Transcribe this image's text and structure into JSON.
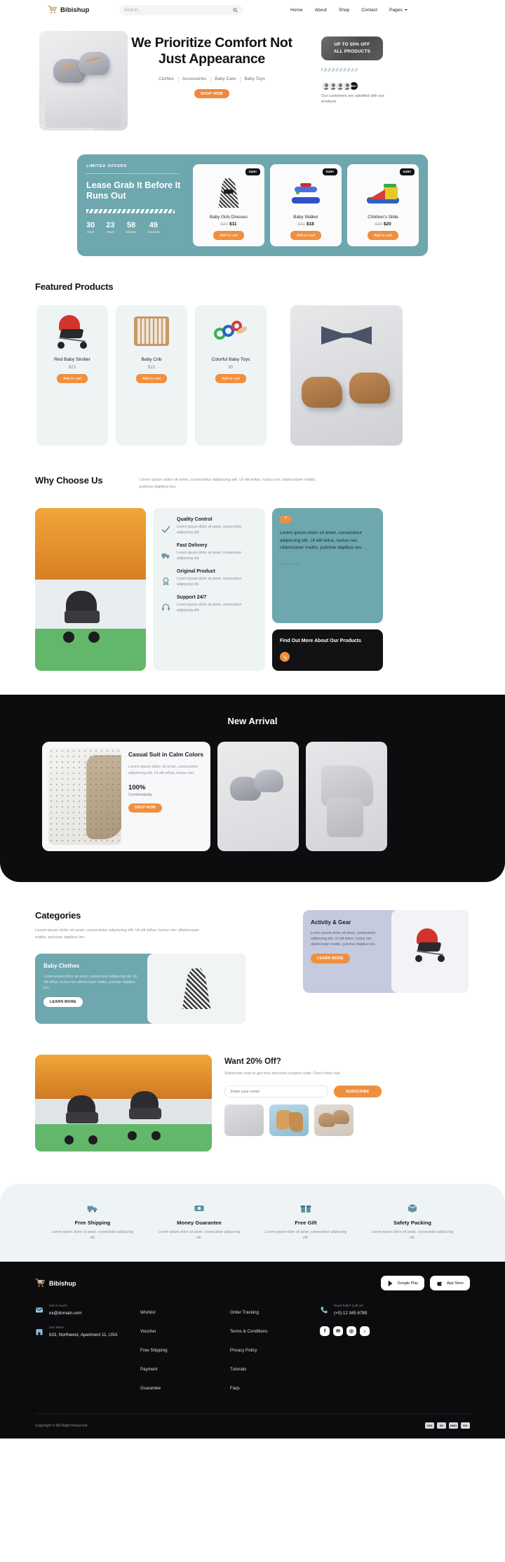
{
  "header": {
    "brand": "Bibishup",
    "search": {
      "placeholder": "Search...",
      "value": ""
    },
    "nav": [
      {
        "label": "Home"
      },
      {
        "label": "About"
      },
      {
        "label": "Shop"
      },
      {
        "label": "Contact"
      },
      {
        "label": "Pages"
      }
    ]
  },
  "hero": {
    "title": "We Prioritize Comfort Not Just Appearance",
    "categories": [
      "Clothes",
      "Accessories",
      "Baby Care",
      "Baby Toys"
    ],
    "cta": "SHOP NOW",
    "promo_line1": "UP TO 50% OFF",
    "promo_line2": "ALL PRODUCTS",
    "avatar_more": "500+",
    "caption": "Our customers are satisfied with our products"
  },
  "offers": {
    "kicker": "LIMITED OFFERS",
    "title": "Lease Grab It Before It Runs Out",
    "countdown": [
      {
        "value": "30",
        "label": "Days"
      },
      {
        "value": "23",
        "label": "Hours"
      },
      {
        "value": "58",
        "label": "Minutes"
      },
      {
        "value": "49",
        "label": "Seconds"
      }
    ],
    "badge": "Sale!",
    "add_to_cart": "Add to cart",
    "products": [
      {
        "name": "Baby Girls Dresses",
        "old_price": "$24",
        "price": "$11"
      },
      {
        "name": "Baby Walker",
        "old_price": "$31",
        "price": "$18"
      },
      {
        "name": "Children's Slide",
        "old_price": "$39",
        "price": "$20"
      }
    ]
  },
  "featured": {
    "title": "Featured Products",
    "add_to_cart": "Add to cart",
    "products": [
      {
        "name": "Red Baby Stroller",
        "price": "$23"
      },
      {
        "name": "Baby Crib",
        "price": "$15"
      },
      {
        "name": "Colorful Baby Toys",
        "price": "$5"
      }
    ]
  },
  "why": {
    "title": "Why Choose Us",
    "description": "Lorem ipsum dolor sit amet, consectetur adipiscing elit. Ut elit tellus, luctus nec ullamcorper mattis, pulvinar dapibus leo.",
    "items": [
      {
        "title": "Quality Control",
        "text": "Lorem ipsum dolor sit amet, consectetur adipiscing elit."
      },
      {
        "title": "Fast Delivery",
        "text": "Lorem ipsum dolor sit amet, consectetur adipiscing elit."
      },
      {
        "title": "Original Product",
        "text": "Lorem ipsum dolor sit amet, consectetur adipiscing elit."
      },
      {
        "title": "Support 24/7",
        "text": "Lorem ipsum dolor sit amet, consectetur adipiscing elit."
      }
    ],
    "quote_mark": "“",
    "quote": "Lorem ipsum dolor sit amet, consectetur adipiscing elit. Ut elit tellus, luctus nec ullamcorper mattis, pulvinar dapibus leo.",
    "quote_author": "5.000 reviews",
    "dark_title": "Find Out More About Our Products",
    "dark_arrow": "↘"
  },
  "arrival": {
    "title": "New Arrival",
    "product_title": "Casual Suit in Calm Colors",
    "product_text": "Lorem ipsum dolor sit amet, consectetur adipiscing elit. Ut elit tellus, luctus nec.",
    "percent": "100%",
    "percent_label": "Comfortability",
    "cta": "SHOP NOW"
  },
  "categories": {
    "title": "Categories",
    "description": "Lorem ipsum dolor sit amet, consectetur adipiscing elit. Ut elit tellus, luctus nec ullamcorper mattis, pulvinar dapibus leo.",
    "baby": {
      "title": "Baby Clothes",
      "text": "Lorem ipsum dolor sit amet, consectetur adipiscing elit. Ut elit tellus, luctus nec ullamcorper mattis, pulvinar dapibus leo.",
      "cta": "LEARN MORE"
    },
    "gear": {
      "title": "Activity & Gear",
      "text": "Lorem ipsum dolor sit amet, consectetur adipiscing elit. Ut elit tellus, luctus nec ullamcorper mattis, pulvinar dapibus leo.",
      "cta": "LEARN MORE"
    }
  },
  "newsletter": {
    "title": "Want 20% Off?",
    "subtitle": "Subscribe now to get free discount coupon code. Don't miss out!",
    "placeholder": "Enter your email",
    "cta": "SUBSCRIBE"
  },
  "benefits": [
    {
      "icon": "truck-icon",
      "title": "Free Shipping",
      "text": "Lorem ipsum dolor sit amet, consectetur adipiscing elit."
    },
    {
      "icon": "money-icon",
      "title": "Money Guarantee",
      "text": "Lorem ipsum dolor sit amet, consectetur adipiscing elit."
    },
    {
      "icon": "gift-icon",
      "title": "Free Gift",
      "text": "Lorem ipsum dolor sit amet, consectetur adipiscing elit."
    },
    {
      "icon": "box-icon",
      "title": "Safety Packing",
      "text": "Lorem ipsum dolor sit amet, consectetur adipiscing elit."
    }
  ],
  "footer": {
    "brand": "Bibishup",
    "google_play": "Google Play",
    "app_store": "App Store",
    "contact": {
      "email_label": "Get in touch",
      "email": "ex@domain.com",
      "store_label": "Our Store",
      "store": "633, Northwest, Apartment 11, USA"
    },
    "links_col1": [
      "Wishlist",
      "Voucher",
      "Free Shipping",
      "Payment",
      "Guarantee"
    ],
    "links_col2": [
      "Order Tracking",
      "Terms & Conditions",
      "Privacy Policy",
      "Tutorials",
      "Faqs"
    ],
    "help_label": "Need help? Call us!",
    "phone": "(+0) 12 345 6789",
    "social": [
      "f",
      "✉",
      "◎",
      "♪"
    ],
    "copyright": "Copyright © All Right Reserved",
    "payment_cards": [
      "VISA",
      "MC",
      "AMEX",
      "PAY"
    ]
  }
}
